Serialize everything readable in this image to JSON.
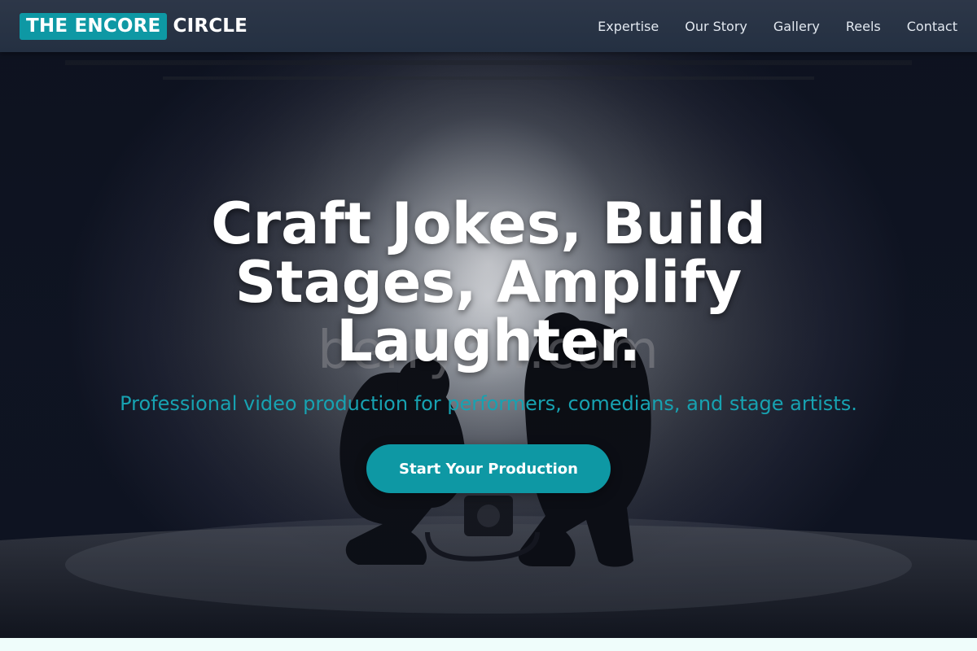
{
  "brand": {
    "logo_box_text": "THE ENCORE",
    "logo_rest_text": "CIRCLE",
    "accent_color": "#0e98a4"
  },
  "nav": {
    "items": [
      {
        "label": "Expertise"
      },
      {
        "label": "Our Story"
      },
      {
        "label": "Gallery"
      },
      {
        "label": "Reels"
      },
      {
        "label": "Contact"
      }
    ]
  },
  "hero": {
    "title": "Craft Jokes, Build Stages, Amplify Laughter.",
    "subtitle": "Professional video production for performers, comedians, and stage artists.",
    "cta_label": "Start Your Production",
    "watermark_text": "berryd...com"
  }
}
